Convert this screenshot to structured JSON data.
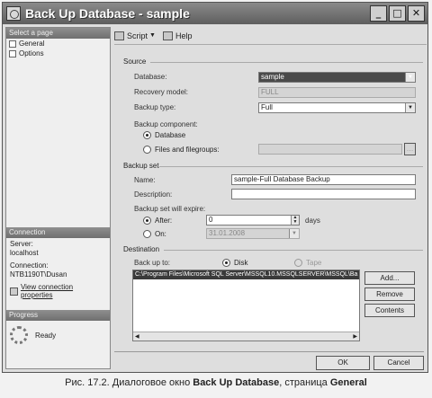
{
  "window": {
    "title": "Back Up Database - sample",
    "minimize": "_",
    "maximize": "□",
    "close": "✕"
  },
  "left_pane": {
    "select_page_header": "Select a page",
    "pages": [
      "General",
      "Options"
    ],
    "connection_header": "Connection",
    "server_label": "Server:",
    "server_value": "localhost",
    "connection_label": "Connection:",
    "connection_value": "NTB1190T\\Dusan",
    "view_connection_link": "View connection properties",
    "progress_header": "Progress",
    "progress_status": "Ready"
  },
  "toolbar": {
    "script_label": "Script",
    "help_label": "Help"
  },
  "source": {
    "section_title": "Source",
    "database_label": "Database:",
    "database_value": "sample",
    "recovery_model_label": "Recovery model:",
    "recovery_model_value": "FULL",
    "backup_type_label": "Backup type:",
    "backup_type_value": "Full",
    "backup_component_label": "Backup component:",
    "component_database": "Database",
    "component_files": "Files and filegroups:"
  },
  "backup_set": {
    "section_title": "Backup set",
    "name_label": "Name:",
    "name_value": "sample-Full Database Backup",
    "description_label": "Description:",
    "description_value": "",
    "expire_label": "Backup set will expire:",
    "after_label": "After:",
    "after_value": "0",
    "days_label": "days",
    "on_label": "On:",
    "on_value": "31.01.2008"
  },
  "destination": {
    "section_title": "Destination",
    "backup_to_label": "Back up to:",
    "disk_label": "Disk",
    "tape_label": "Tape",
    "path": "C:\\Program Files\\Microsoft SQL Server\\MSSQL10.MSSQLSERVER\\MSSQL\\Ba",
    "add_button": "Add...",
    "remove_button": "Remove",
    "contents_button": "Contents"
  },
  "footer": {
    "ok_button": "OK",
    "cancel_button": "Cancel"
  },
  "caption": {
    "prefix": "Рис. 17.2. Диалоговое окно ",
    "dialog_name": "Back Up Database",
    "middle": ", страница ",
    "page_name": "General"
  }
}
